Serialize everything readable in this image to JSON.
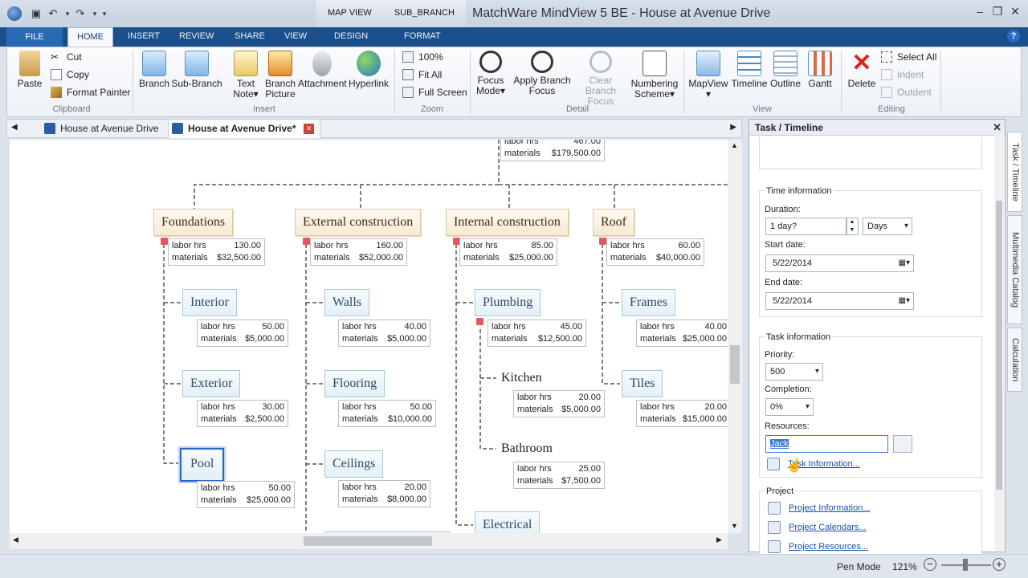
{
  "window": {
    "title": "MatchWare MindView 5 BE - House  at Avenue Drive",
    "context_tabs": [
      "MAP VIEW",
      "SUB_BRANCH"
    ]
  },
  "ribbon_tabs": [
    "FILE",
    "HOME",
    "INSERT",
    "REVIEW",
    "SHARE",
    "VIEW",
    "DESIGN",
    "FORMAT"
  ],
  "clipboard": {
    "paste": "Paste",
    "cut": "Cut",
    "copy": "Copy",
    "format_painter": "Format Painter",
    "group": "Clipboard"
  },
  "insert": {
    "branch": "Branch",
    "sub_branch": "Sub-Branch",
    "text_note_1": "Text",
    "text_note_2": "Note",
    "branch_picture_1": "Branch",
    "branch_picture_2": "Picture",
    "attachment": "Attachment",
    "hyperlink": "Hyperlink",
    "group": "Insert"
  },
  "zoom": {
    "z100": "100%",
    "fit_all": "Fit All",
    "full_screen": "Full Screen",
    "group": "Zoom"
  },
  "detail": {
    "focus_mode_1": "Focus",
    "focus_mode_2": "Mode",
    "apply_focus_1": "Apply Branch",
    "apply_focus_2": "Focus",
    "clear_focus_1": "Clear Branch",
    "clear_focus_2": "Focus",
    "numbering_1": "Numbering",
    "numbering_2": "Scheme",
    "group": "Detail"
  },
  "view": {
    "mapview": "MapView",
    "timeline": "Timeline",
    "outline": "Outline",
    "gantt": "Gantt",
    "group": "View"
  },
  "editing": {
    "delete": "Delete",
    "select_all": "Select All",
    "indent": "Indent",
    "outdent": "Outdent",
    "group": "Editing"
  },
  "doc_tabs": [
    "House at Avenue Drive",
    "House  at Avenue Drive*"
  ],
  "map": {
    "root": {
      "hrs": "467.00",
      "mat": "$179,500.00"
    },
    "topics": [
      {
        "name": "Foundations",
        "hrs": "130.00",
        "mat": "$32,500.00"
      },
      {
        "name": "External construction",
        "hrs": "160.00",
        "mat": "$52,000.00"
      },
      {
        "name": "Internal construction",
        "hrs": "85.00",
        "mat": "$25,000.00"
      },
      {
        "name": "Roof",
        "hrs": "60.00",
        "mat": "$40,000.00"
      }
    ],
    "subs": {
      "interior": {
        "name": "Interior",
        "hrs": "50.00",
        "mat": "$5,000.00"
      },
      "exterior": {
        "name": "Exterior",
        "hrs": "30.00",
        "mat": "$2,500.00"
      },
      "pool": {
        "name": "Pool",
        "hrs": "50.00",
        "mat": "$25,000.00"
      },
      "walls": {
        "name": "Walls",
        "hrs": "40.00",
        "mat": "$5,000.00"
      },
      "flooring": {
        "name": "Flooring",
        "hrs": "50.00",
        "mat": "$10,000.00"
      },
      "ceilings": {
        "name": "Ceilings",
        "hrs": "20.00",
        "mat": "$8,000.00"
      },
      "plumbing": {
        "name": "Plumbing",
        "hrs": "45.00",
        "mat": "$12,500.00"
      },
      "kitchen": {
        "name": "Kitchen",
        "hrs": "20.00",
        "mat": "$5,000.00"
      },
      "bathroom": {
        "name": "Bathroom",
        "hrs": "25.00",
        "mat": "$7,500.00"
      },
      "electrical": {
        "name": "Electrical"
      },
      "frames": {
        "name": "Frames",
        "hrs": "40.00",
        "mat": "$25,000.00"
      },
      "tiles": {
        "name": "Tiles",
        "hrs": "20.00",
        "mat": "$15,000.00"
      }
    },
    "labels": {
      "hrs": "labor hrs",
      "mat": "materials"
    }
  },
  "pane": {
    "title": "Task / Timeline",
    "time_info": "Time information",
    "duration_label": "Duration:",
    "duration": "1 day?",
    "duration_unit": "Days",
    "start_label": "Start date:",
    "start": "5/22/2014",
    "end_label": "End date:",
    "end": "5/22/2014",
    "task_info": "Task information",
    "priority_label": "Priority:",
    "priority": "500",
    "completion_label": "Completion:",
    "completion": "0%",
    "resources_label": "Resources:",
    "resources": "Jack",
    "task_info_link": "Task Information...",
    "project": "Project",
    "project_info": "Project Information...",
    "project_calendars": "Project Calendars...",
    "project_resources": "Project Resources..."
  },
  "side_tabs": [
    "Task / Timeline",
    "Multimedia Catalog",
    "Calculation"
  ],
  "status": {
    "mode": "Pen Mode",
    "zoom": "121%"
  }
}
